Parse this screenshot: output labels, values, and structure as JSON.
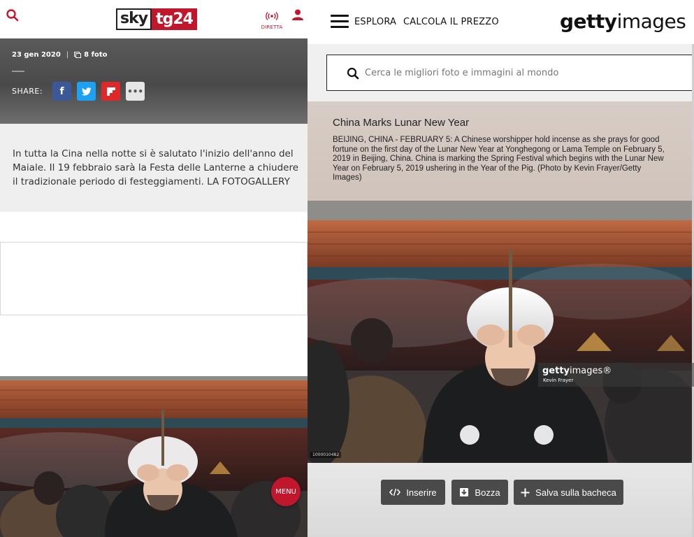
{
  "sky": {
    "logo_sky": "sky",
    "logo_tg": "tg24",
    "live_label": "DIRETTA",
    "date": "23 gen 2020",
    "separator": "|",
    "photo_count": "8 foto",
    "share_label": "SHARE:",
    "share_buttons": {
      "facebook": "f",
      "twitter": "t",
      "flipboard": "f",
      "more": "•••"
    },
    "summary": "In tutta la Cina nella notte si è salutato l'inizio dell'anno del Maiale. Il 19 febbraio sarà la Festa delle Lanterne a chiudere il tradizionale periodo di festeggiamenti. LA FOTOGALLERY",
    "menu_label": "MENU"
  },
  "getty": {
    "nav": {
      "explore": "ESPLORA",
      "pricing": "CALCOLA IL PREZZO"
    },
    "logo_bold": "getty",
    "logo_light": "images",
    "search": {
      "placeholder": "Cerca le migliori foto e immagini al mondo"
    },
    "caption_title": "China Marks Lunar New Year",
    "caption_text": "BEIJING, CHINA - FEBRUARY 5: A Chinese worshipper hold incense as she prays for good fortune on the first day of the Lunar New Year at Yonghegong or Lama Temple on February 5, 2019 in Beijing, China. China is marking the Spring Festival which begins with the Lunar New Year on February 5, 2019 ushering in the Year of the Pig. (Photo by Kevin Frayer/Getty Images)",
    "watermark_bold": "getty",
    "watermark_light": "images",
    "watermark_reg": "®",
    "photo_credit": "Kevin Frayer",
    "image_id": "1000010482",
    "actions": {
      "embed": "Inserire",
      "draft": "Bozza",
      "save": "Salva sulla bacheca"
    }
  },
  "colors": {
    "sky_red": "#c0172d",
    "facebook": "#3b5998",
    "twitter": "#1da1f2",
    "flipboard": "#e02828",
    "getty_button": "#4a4a4a"
  }
}
